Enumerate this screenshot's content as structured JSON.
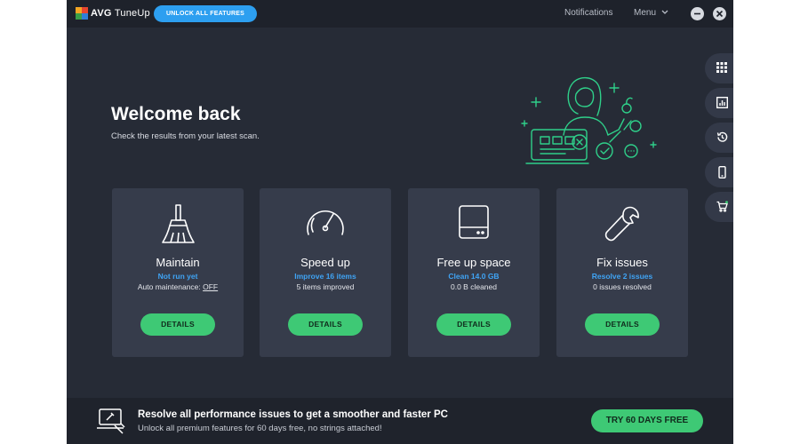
{
  "titlebar": {
    "brand_bold": "AVG",
    "brand_light": "TuneUp",
    "unlock_label": "UNLOCK ALL FEATURES",
    "notifications_label": "Notifications",
    "menu_label": "Menu",
    "menu_chevron": "⌄"
  },
  "hero": {
    "heading": "Welcome back",
    "subtitle": "Check the results from your latest scan."
  },
  "sidebar": {
    "icons": [
      "apps-grid-icon",
      "bar-chart-icon",
      "history-icon",
      "phone-icon",
      "cart-icon"
    ]
  },
  "cards": [
    {
      "icon": "broom-icon",
      "title": "Maintain",
      "status": "Not run yet",
      "detail_prefix": "Auto maintenance: ",
      "detail_value": "OFF",
      "button": "DETAILS"
    },
    {
      "icon": "speedometer-icon",
      "title": "Speed up",
      "status": "Improve 16 items",
      "detail": "5 items improved",
      "button": "DETAILS"
    },
    {
      "icon": "hard-drive-icon",
      "title": "Free up space",
      "status": "Clean 14.0 GB",
      "detail": "0.0 B cleaned",
      "button": "DETAILS"
    },
    {
      "icon": "wrench-icon",
      "title": "Fix issues",
      "status": "Resolve 2 issues",
      "detail": "0 issues resolved",
      "button": "DETAILS"
    }
  ],
  "promo": {
    "headline": "Resolve all performance issues to get a smoother and faster PC",
    "subline": "Unlock all premium features for 60 days free, no strings attached!",
    "cta": "TRY 60 DAYS FREE"
  },
  "colors": {
    "background": "#262b36",
    "titlebar": "#1e222b",
    "card": "#363c4b",
    "accent_green": "#3ec975",
    "accent_blue": "#2d9ff0",
    "illustration_green": "#2fd08a"
  }
}
